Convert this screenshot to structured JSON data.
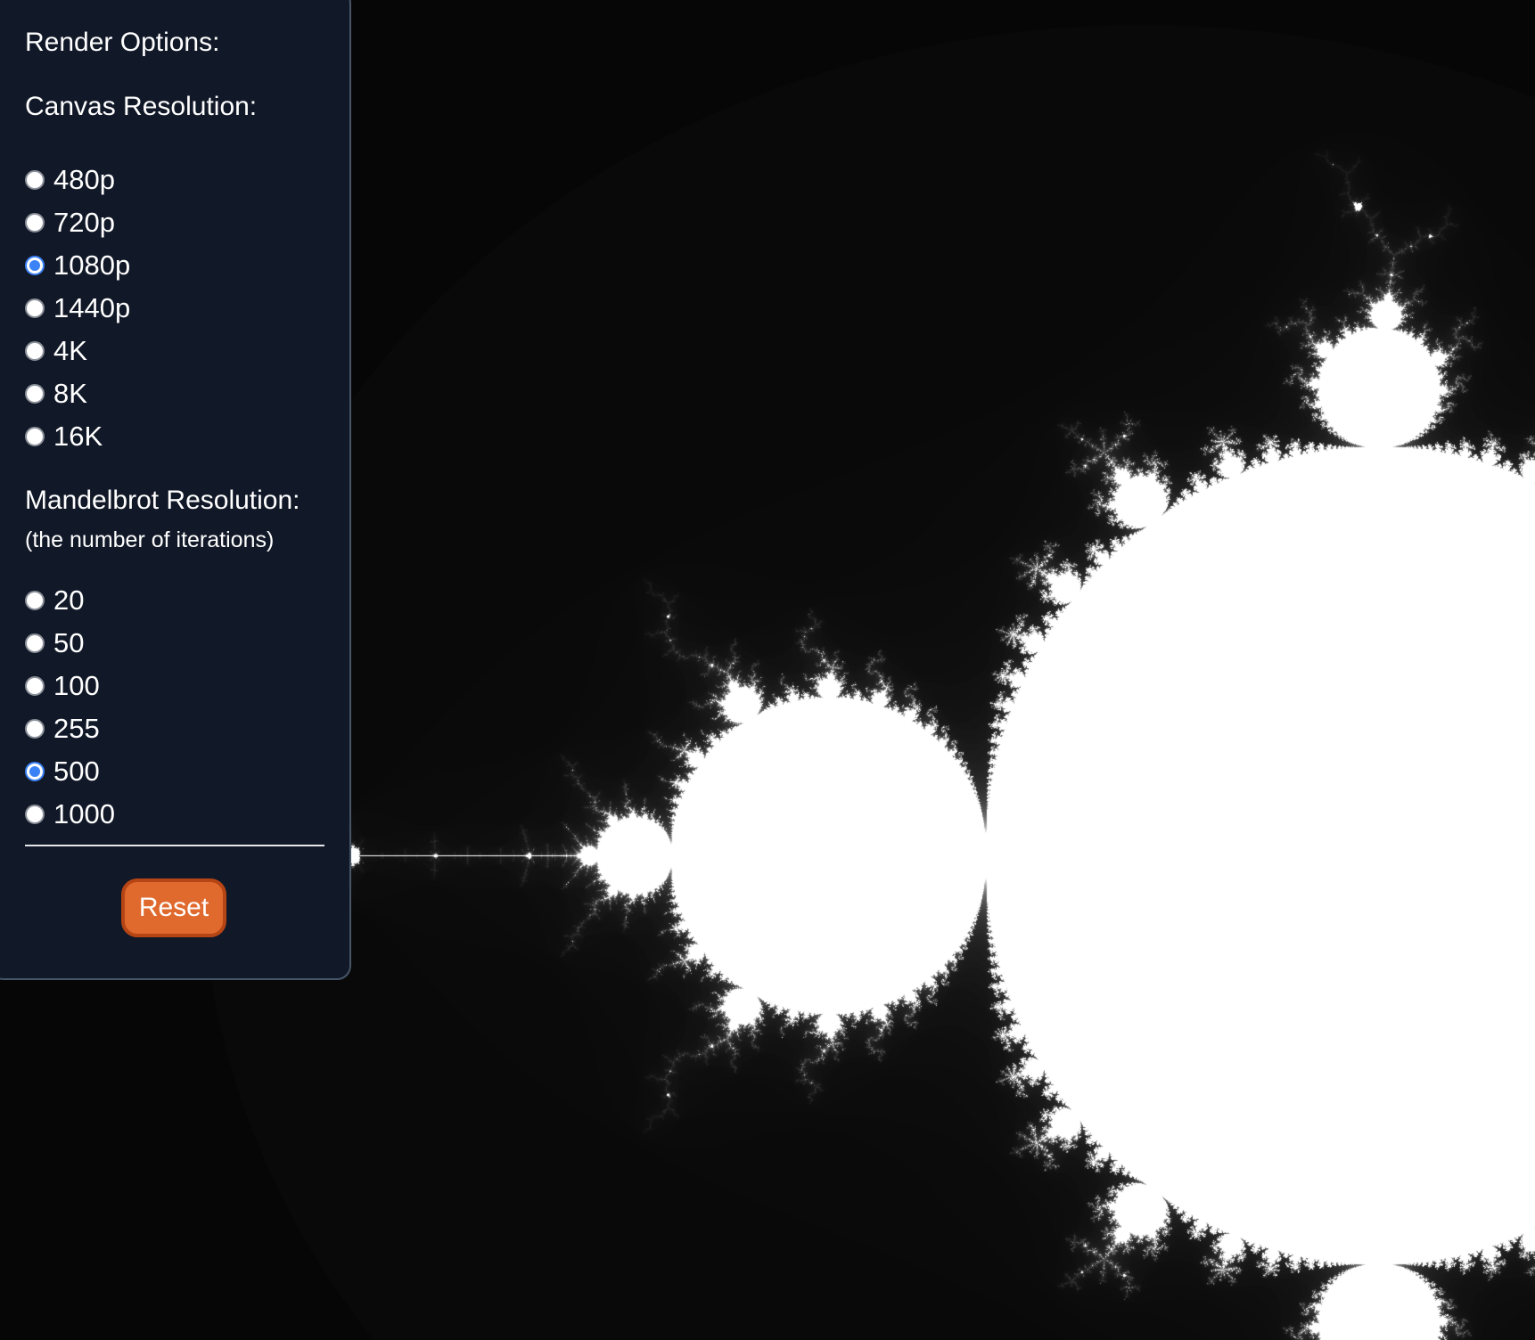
{
  "panel": {
    "title": "Render Options:",
    "canvas_resolution": {
      "heading": "Canvas Resolution:",
      "options": [
        "480p",
        "720p",
        "1080p",
        "1440p",
        "4K",
        "8K",
        "16K"
      ],
      "selected": "1080p"
    },
    "mandelbrot_resolution": {
      "heading": "Mandelbrot Resolution:",
      "subheading": "(the number of iterations)",
      "options": [
        "20",
        "50",
        "100",
        "255",
        "500",
        "1000"
      ],
      "selected": "500"
    },
    "reset_label": "Reset"
  },
  "colors": {
    "panel_background": "#111827",
    "panel_border": "#475569",
    "radio_selected": "#3b82f6",
    "reset_button": "#e06a2e",
    "reset_border": "#b64516",
    "canvas_background": "#000000",
    "fractal_set": "#ffffff"
  }
}
